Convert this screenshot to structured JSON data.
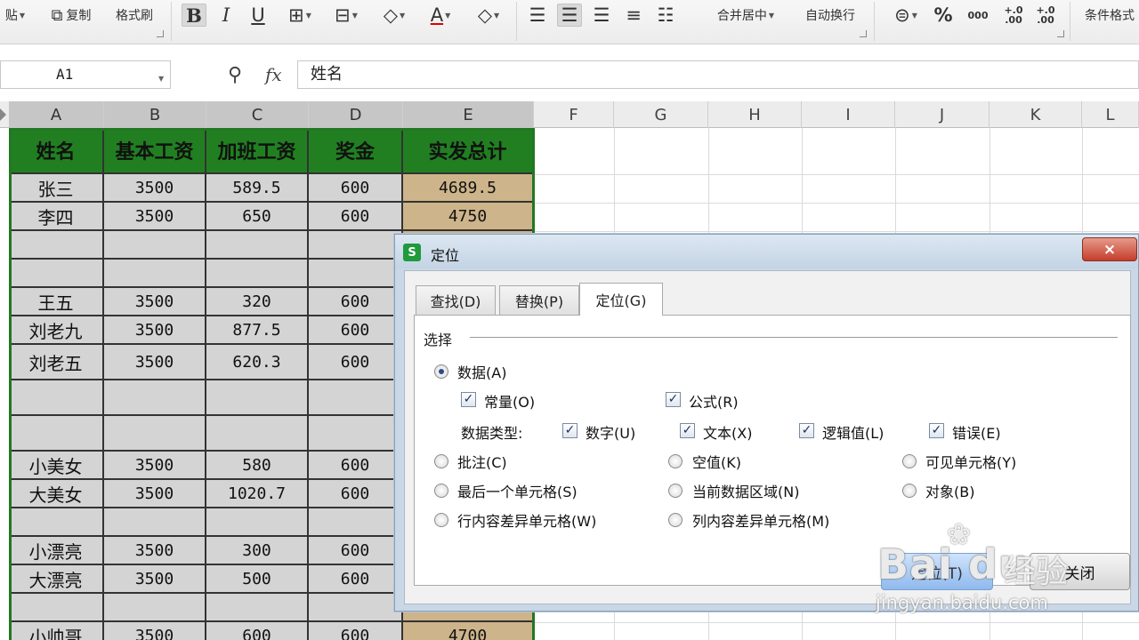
{
  "ribbon": {
    "paste": "贴",
    "copy": "复制",
    "format_painter": "格式刷",
    "bold": "B",
    "italic": "I",
    "underline": "U",
    "merge_center": "合并居中",
    "wrap_text": "自动换行",
    "percent": "%",
    "thousands": "000",
    "inc_decimal": "+.0 .00",
    "dec_decimal": "+.0 .00",
    "conditional_format": "条件格式"
  },
  "formula_bar": {
    "cell_ref": "A1",
    "fx": "fx",
    "value": "姓名"
  },
  "columns": [
    "A",
    "B",
    "C",
    "D",
    "E",
    "F",
    "G",
    "H",
    "I",
    "J",
    "K",
    "L"
  ],
  "table": {
    "headers": [
      "姓名",
      "基本工资",
      "加班工资",
      "奖金",
      "实发总计"
    ],
    "rows": [
      [
        "张三",
        "3500",
        "589.5",
        "600",
        "4689.5"
      ],
      [
        "李四",
        "3500",
        "650",
        "600",
        "4750"
      ],
      [
        "",
        "",
        "",
        "",
        ""
      ],
      [
        "",
        "",
        "",
        "",
        ""
      ],
      [
        "王五",
        "3500",
        "320",
        "600",
        ""
      ],
      [
        "刘老九",
        "3500",
        "877.5",
        "600",
        ""
      ],
      [
        "刘老五",
        "3500",
        "620.3",
        "600",
        ""
      ],
      [
        "",
        "",
        "",
        "",
        ""
      ],
      [
        "",
        "",
        "",
        "",
        ""
      ],
      [
        "小美女",
        "3500",
        "580",
        "600",
        ""
      ],
      [
        "大美女",
        "3500",
        "1020.7",
        "600",
        ""
      ],
      [
        "",
        "",
        "",
        "",
        ""
      ],
      [
        "小漂亮",
        "3500",
        "300",
        "600",
        ""
      ],
      [
        "大漂亮",
        "3500",
        "500",
        "600",
        ""
      ],
      [
        "",
        "",
        "",
        "",
        ""
      ],
      [
        "小帅哥",
        "3500",
        "600",
        "600",
        "4700"
      ]
    ]
  },
  "dialog": {
    "title": "定位",
    "app_icon": "S",
    "close": "×",
    "tabs": [
      "查找(D)",
      "替换(P)",
      "定位(G)"
    ],
    "active_tab": 2,
    "group_label": "选择",
    "options": {
      "data": "数据(A)",
      "constants": "常量(O)",
      "formulas": "公式(R)",
      "data_type_label": "数据类型:",
      "numbers": "数字(U)",
      "text": "文本(X)",
      "logicals": "逻辑值(L)",
      "errors": "错误(E)",
      "comments": "批注(C)",
      "blanks": "空值(K)",
      "visible_cells": "可见单元格(Y)",
      "last_cell": "最后一个单元格(S)",
      "current_region": "当前数据区域(N)",
      "objects": "对象(B)",
      "row_diff": "行内容差异单元格(W)",
      "col_diff": "列内容差异单元格(M)"
    },
    "ok": "定位(T)",
    "close_button": "关闭"
  },
  "watermark": {
    "logo": "Bai du",
    "text": "经验",
    "url": "jingyan.baidu.com"
  },
  "colors": {
    "header_green": "#217f21",
    "selection_grey": "#d4d4d4",
    "total_tan": "#cdb48a"
  }
}
